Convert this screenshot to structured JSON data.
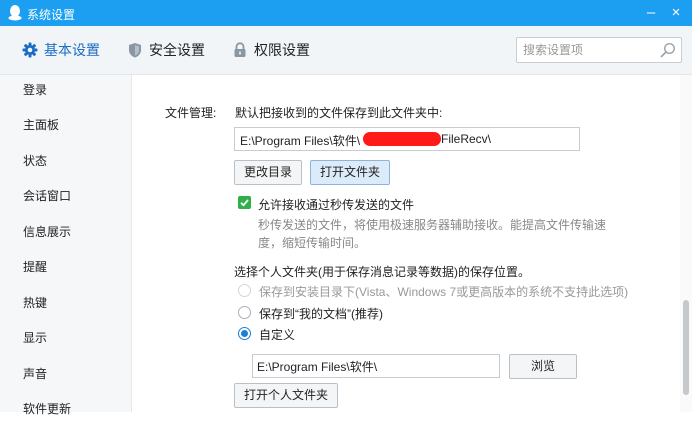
{
  "window": {
    "title": "系统设置",
    "minimize": "–",
    "close": "×"
  },
  "tabs": [
    {
      "label": "基本设置",
      "icon": "gear-icon",
      "active": true
    },
    {
      "label": "安全设置",
      "icon": "shield-icon",
      "active": false
    },
    {
      "label": "权限设置",
      "icon": "lock-icon",
      "active": false
    }
  ],
  "search": {
    "placeholder": "搜索设置项",
    "icon": "search-icon"
  },
  "sidebar": {
    "items": [
      {
        "label": "登录"
      },
      {
        "label": "主面板"
      },
      {
        "label": "状态"
      },
      {
        "label": "会话窗口"
      },
      {
        "label": "信息展示"
      },
      {
        "label": "提醒"
      },
      {
        "label": "热键"
      },
      {
        "label": "显示"
      },
      {
        "label": "声音"
      },
      {
        "label": "软件更新"
      }
    ]
  },
  "file_management": {
    "section_label": "文件管理:",
    "default_save_label": "默认把接收到的文件保存到此文件夹中:",
    "path_prefix": "E:\\Program Files\\软件\\",
    "path_suffix": "FileRecv\\",
    "change_dir_button": "更改目录",
    "open_folder_button": "打开文件夹",
    "allow_flash_transfer": {
      "label": "允许接收通过秒传发送的文件",
      "checked": true,
      "description_line1": "秒传发送的文件，将使用极速服务器辅助接收。能提高文件传输速",
      "description_line2": "度，缩短传输时间。"
    }
  },
  "personal_folder": {
    "heading": "选择个人文件夹(用于保存消息记录等数据)的保存位置。",
    "options": [
      {
        "label": "保存到安装目录下(Vista、Windows 7或更高版本的系统不支持此选项)",
        "disabled": true,
        "selected": false
      },
      {
        "label": "保存到“我的文档”(推荐)",
        "disabled": false,
        "selected": false
      },
      {
        "label": "自定义",
        "disabled": false,
        "selected": true
      }
    ],
    "custom_path": "E:\\Program Files\\软件\\",
    "browse_button": "浏览",
    "open_personal_folder_button": "打开个人文件夹"
  },
  "colors": {
    "titlebar": "#1c9ff0",
    "active_tab": "#1b6dc4",
    "checkbox": "#30b04b",
    "redaction": "#ff1a1a"
  }
}
